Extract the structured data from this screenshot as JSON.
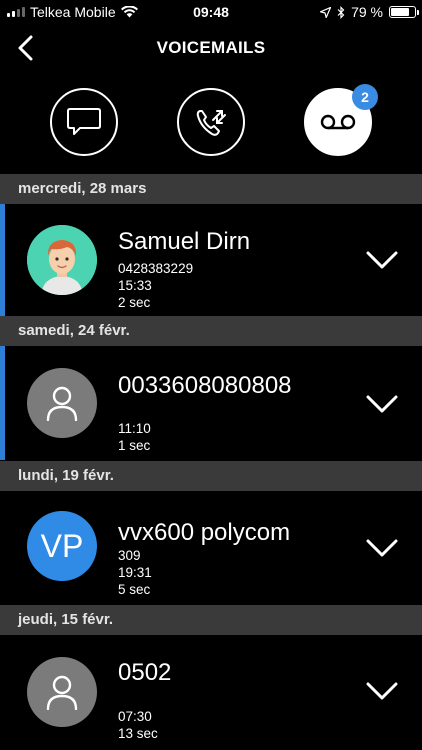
{
  "status_bar": {
    "carrier": "Telkea Mobile",
    "time": "09:48",
    "battery": "79 %",
    "battery_level": 0.79
  },
  "header": {
    "title": "VOICEMAILS"
  },
  "tabs": {
    "voicemail_badge": "2"
  },
  "sections": [
    {
      "date": "mercredi, 28 mars",
      "entry": {
        "name": "Samuel Dirn",
        "number": "0428383229",
        "time": "15:33",
        "duration": "2 sec",
        "unread": true,
        "avatar": "photo"
      }
    },
    {
      "date": "samedi, 24 févr.",
      "entry": {
        "name": "0033608080808",
        "number": "",
        "time": "11:10",
        "duration": "1 sec",
        "unread": true,
        "avatar": "person-icon"
      }
    },
    {
      "date": "lundi, 19 févr.",
      "entry": {
        "name": "vvx600 polycom",
        "number": "309",
        "time": "19:31",
        "duration": "5 sec",
        "unread": false,
        "avatar": "initials",
        "initials": "VP"
      }
    },
    {
      "date": "jeudi, 15 févr.",
      "entry": {
        "name": "0502",
        "number": "",
        "time": "07:30",
        "duration": "13 sec",
        "unread": false,
        "avatar": "person-icon"
      }
    }
  ],
  "colors": {
    "accent": "#2f7fd8",
    "badge": "#3a8be2",
    "section_header": "#3a3a3a",
    "avatar_gray": "#7b7b7b",
    "avatar_blue": "#2f8be6"
  }
}
